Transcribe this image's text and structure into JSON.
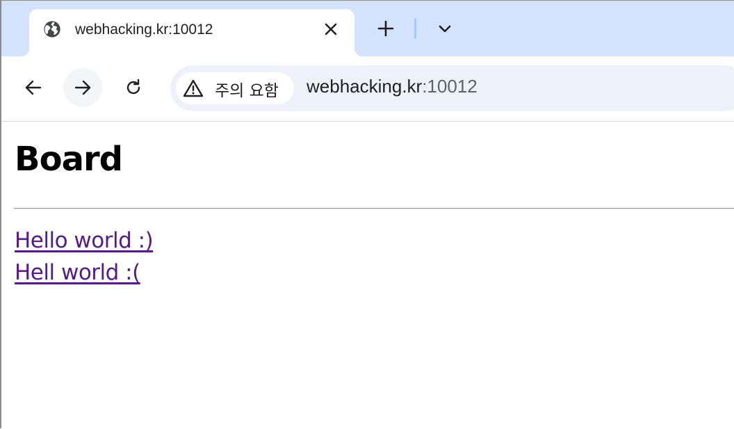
{
  "browser": {
    "tab": {
      "title": "webhacking.kr:10012",
      "favicon": "globe-icon"
    },
    "toolbar": {
      "security_label": "주의 요함",
      "url_host": "webhacking.kr",
      "url_port": ":10012"
    },
    "colors": {
      "tabstrip_bg": "#d3e3fd",
      "omnibox_bg": "#edf2fa",
      "visited_link": "#551a8b"
    }
  },
  "page": {
    "title": "Board",
    "posts": [
      {
        "label": "Hello world :)"
      },
      {
        "label": "Hell world :("
      }
    ]
  }
}
